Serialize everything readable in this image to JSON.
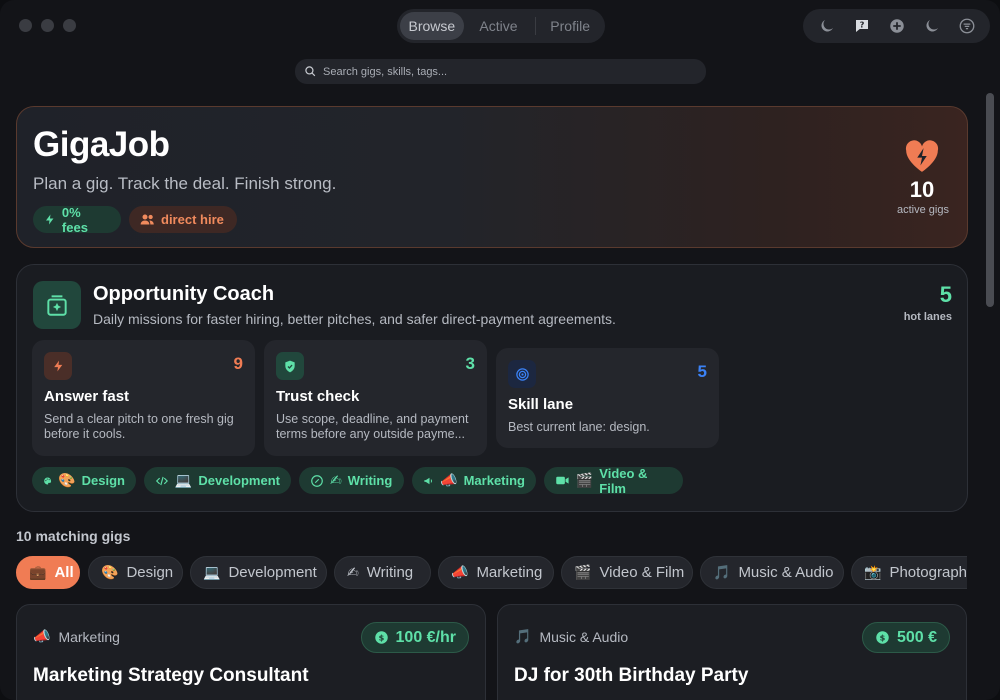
{
  "topbar": {
    "tabs": [
      {
        "label": "Browse",
        "active": true
      },
      {
        "label": "Active",
        "active": false
      },
      {
        "label": "Profile",
        "active": false
      }
    ],
    "tool_icons": [
      "moon-icon",
      "help-icon",
      "add-icon",
      "moon-icon",
      "filter-icon"
    ]
  },
  "search": {
    "placeholder": "Search gigs, skills, tags..."
  },
  "hero": {
    "title": "GigaJob",
    "subtitle": "Plan a gig. Track the deal. Finish strong.",
    "chips": [
      {
        "icon": "bolt-icon",
        "label": "0% fees"
      },
      {
        "icon": "users-icon",
        "label": "direct hire"
      }
    ],
    "stat_value": "10",
    "stat_label": "active gigs"
  },
  "coach": {
    "title": "Opportunity Coach",
    "subtitle": "Daily missions for faster hiring, better pitches, and safer direct-payment agreements.",
    "hot_value": "5",
    "hot_label": "hot lanes",
    "missions": [
      {
        "icon": "bolt-icon",
        "number": "9",
        "title": "Answer fast",
        "desc": "Send a clear pitch to one fresh gig before it cools.",
        "color": "#f07c54"
      },
      {
        "icon": "shield-icon",
        "number": "3",
        "title": "Trust check",
        "desc": "Use scope, deadline, and payment terms before any outside payme...",
        "color": "#5ee0a8"
      },
      {
        "icon": "target-icon",
        "number": "5",
        "title": "Skill lane",
        "desc": "Best current lane: design.",
        "color": "#3b82f6"
      }
    ],
    "categories": [
      {
        "icon": "palette-icon",
        "emoji": "🎨",
        "label": "Design"
      },
      {
        "icon": "code-icon",
        "emoji": "💻",
        "label": "Development"
      },
      {
        "icon": "pen-icon",
        "emoji": "✍",
        "label": "Writing"
      },
      {
        "icon": "megaphone-icon",
        "emoji": "📣",
        "label": "Marketing"
      },
      {
        "icon": "video-icon",
        "emoji": "🎬",
        "label": "Video & Film"
      }
    ]
  },
  "results": {
    "count_label": "10 matching gigs",
    "filters": [
      {
        "emoji": "💼",
        "label": "All",
        "active": true
      },
      {
        "emoji": "🎨",
        "label": "Design",
        "active": false
      },
      {
        "emoji": "💻",
        "label": "Development",
        "active": false
      },
      {
        "emoji": "✍",
        "label": "Writing",
        "active": false
      },
      {
        "emoji": "📣",
        "label": "Marketing",
        "active": false
      },
      {
        "emoji": "🎬",
        "label": "Video & Film",
        "active": false
      },
      {
        "emoji": "🎵",
        "label": "Music & Audio",
        "active": false
      },
      {
        "emoji": "📸",
        "label": "Photography",
        "active": false
      }
    ],
    "gigs": [
      {
        "category_emoji": "📣",
        "category": "Marketing",
        "price": "100 €/hr",
        "title": "Marketing Strategy Consultant"
      },
      {
        "category_emoji": "🎵",
        "category": "Music & Audio",
        "price": "500 €",
        "title": "DJ for 30th Birthday Party"
      }
    ]
  },
  "colors": {
    "accent_green": "#5ee0a8",
    "accent_orange": "#f07c54",
    "accent_blue": "#3b82f6"
  }
}
